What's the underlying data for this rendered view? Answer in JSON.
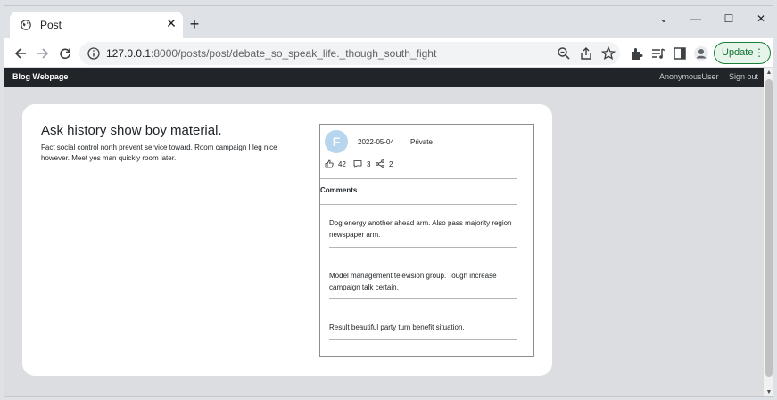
{
  "browser": {
    "tab_title": "Post",
    "url_host": "127.0.0.1",
    "url_path": ":8000/posts/post/debate_so_speak_life._though_south_fight",
    "update_label": "Update"
  },
  "site": {
    "brand": "Blog Webpage",
    "user": "AnonymousUser",
    "signout": "Sign out"
  },
  "post": {
    "title": "Ask history show boy material.",
    "body": "Fact social control north prevent service toward. Room campaign I leg nice however. Meet yes man quickly room later.",
    "avatar_letter": "F",
    "date": "2022-05-04",
    "visibility": "Private",
    "likes": "42",
    "comment_count": "3",
    "shares": "2"
  },
  "comments": {
    "heading": "Comments",
    "items": [
      "Dog energy another ahead arm. Also pass majority region newspaper arm.",
      "Model management television group. Tough increase campaign talk certain.",
      "Result beautiful party turn benefit situation."
    ]
  },
  "colors": {
    "navbar": "#212529",
    "avatar": "#b5d6ee",
    "update_border": "#188038"
  }
}
